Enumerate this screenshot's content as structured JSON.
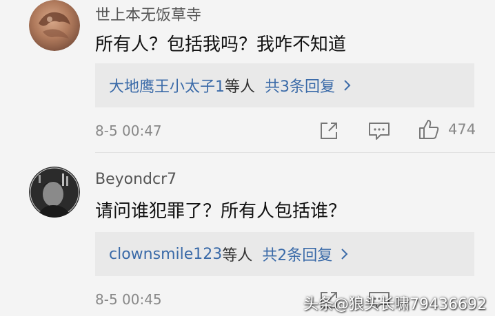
{
  "comments": [
    {
      "username": "世上本无饭草寺",
      "text": "所有人？包括我吗？我咋不知道",
      "reply_names": "大地鹰王小太子1",
      "reply_suffix": "等人",
      "reply_count": "共3条回复",
      "timestamp": "8-5 00:47",
      "likes": "474"
    },
    {
      "username": "Beyondcr7",
      "text": "请问谁犯罪了？所有人包括谁？",
      "reply_names": "clownsmile123",
      "reply_suffix": "等人",
      "reply_count": "共2条回复",
      "timestamp": "8-5 00:45"
    }
  ],
  "watermark": "头条@狼头长啸79436692",
  "colors": {
    "background": "#f4f4f4",
    "reply_box": "#e9e9e9",
    "link_blue": "#3a6aa8",
    "muted_text": "#888888"
  }
}
